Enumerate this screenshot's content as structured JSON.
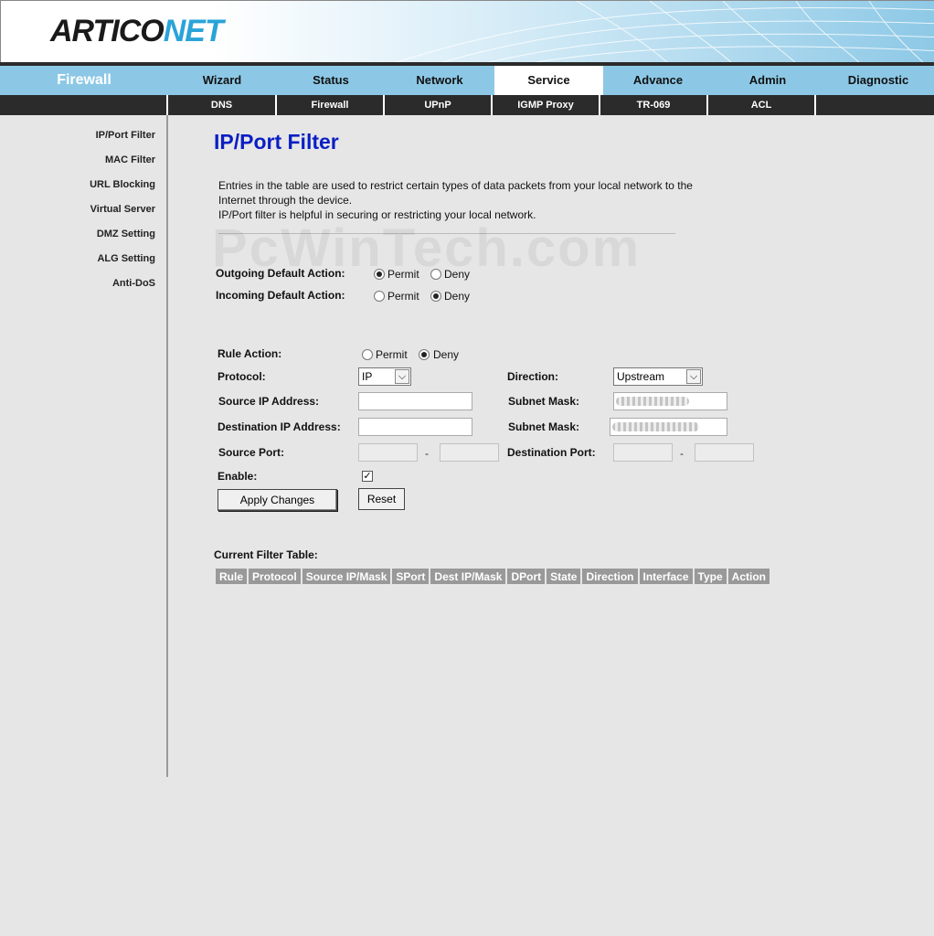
{
  "header": {
    "logo_prefix": "ARTICO",
    "logo_suffix": "NET",
    "watermark": "PcWinTech.com"
  },
  "mainnav": {
    "section_title": "Firewall",
    "tabs": [
      {
        "label": "Wizard"
      },
      {
        "label": "Status"
      },
      {
        "label": "Network"
      },
      {
        "label": "Service",
        "active": true
      },
      {
        "label": "Advance"
      },
      {
        "label": "Admin"
      },
      {
        "label": "Diagnostic"
      }
    ]
  },
  "subnav": {
    "tabs": [
      {
        "label": "DNS"
      },
      {
        "label": "Firewall"
      },
      {
        "label": "UPnP"
      },
      {
        "label": "IGMP Proxy"
      },
      {
        "label": "TR-069"
      },
      {
        "label": "ACL"
      }
    ]
  },
  "sidebar": {
    "items": [
      {
        "label": "IP/Port Filter"
      },
      {
        "label": "MAC Filter"
      },
      {
        "label": "URL Blocking"
      },
      {
        "label": "Virtual Server"
      },
      {
        "label": "DMZ Setting"
      },
      {
        "label": "ALG Setting"
      },
      {
        "label": "Anti-DoS"
      }
    ]
  },
  "page": {
    "title": "IP/Port Filter",
    "desc_line1": "Entries in the table are used to restrict certain types of data packets from your local network to the",
    "desc_line2": "Internet through the device.",
    "desc_line3": "IP/Port filter is helpful in securing or restricting your local network."
  },
  "defaults": {
    "outgoing_label": "Outgoing Default Action:",
    "incoming_label": "Incoming Default Action:",
    "permit": "Permit",
    "deny": "Deny",
    "outgoing_value": "Permit",
    "incoming_value": "Deny"
  },
  "rule": {
    "action_label": "Rule Action:",
    "action_value": "Deny",
    "protocol_label": "Protocol:",
    "protocol_value": "IP",
    "direction_label": "Direction:",
    "direction_value": "Upstream",
    "src_ip_label": "Source IP Address:",
    "dst_ip_label": "Destination IP Address:",
    "subnet_label": "Subnet Mask:",
    "src_port_label": "Source Port:",
    "dst_port_label": "Destination Port:",
    "port_dash": "-",
    "enable_label": "Enable:",
    "enable_checked": true,
    "apply_label": "Apply Changes",
    "reset_label": "Reset"
  },
  "filter_table": {
    "title": "Current Filter Table:",
    "columns": [
      "Rule",
      "Protocol",
      "Source IP/Mask",
      "SPort",
      "Dest IP/Mask",
      "DPort",
      "State",
      "Direction",
      "Interface",
      "Type",
      "Action"
    ]
  }
}
